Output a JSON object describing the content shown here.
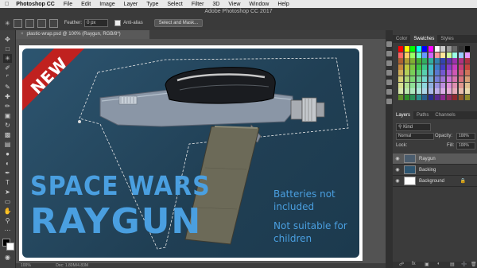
{
  "menubar": {
    "apple": "",
    "app": "Photoshop CC",
    "items": [
      "File",
      "Edit",
      "Image",
      "Layer",
      "Type",
      "Select",
      "Filter",
      "3D",
      "View",
      "Window",
      "Help"
    ]
  },
  "window_title": "Adobe Photoshop CC 2017",
  "options": {
    "feather_label": "Feather:",
    "feather_value": "0 px",
    "antialias_label": "Anti-alias",
    "select_mask_button": "Select and Mask..."
  },
  "document": {
    "tab_title": "plastic-wrap.psd @ 100% (Raygun, RGB/8*)",
    "status_zoom": "100%",
    "status_doc": "Doc: 1.80M/4.83M"
  },
  "artwork": {
    "badge": "NEW",
    "title_line1": "SPACE WARS",
    "title_line2": "RAYGUN",
    "note1_line1": "Batteries not",
    "note1_line2": "included",
    "note2_line1": "Not suitable for",
    "note2_line2": "children"
  },
  "panels": {
    "top_tabs": [
      "Color",
      "Swatches",
      "Styles"
    ],
    "top_active": "Swatches",
    "layers_tabs": [
      "Layers",
      "Paths",
      "Channels"
    ],
    "layers_active": "Layers",
    "kind_label": "Kind",
    "blend_mode": "Normal",
    "opacity_label": "Opacity:",
    "opacity_value": "100%",
    "lock_label": "Lock:",
    "fill_label": "Fill:",
    "fill_value": "100%",
    "layers": [
      {
        "name": "Raygun",
        "selected": true
      },
      {
        "name": "Backing",
        "selected": false
      },
      {
        "name": "Background",
        "selected": false
      }
    ]
  },
  "colors": {
    "accent_selected_layer": "#5a5a5a",
    "art_text_blue": "#4a9fe0",
    "badge_red": "#c0211f"
  }
}
